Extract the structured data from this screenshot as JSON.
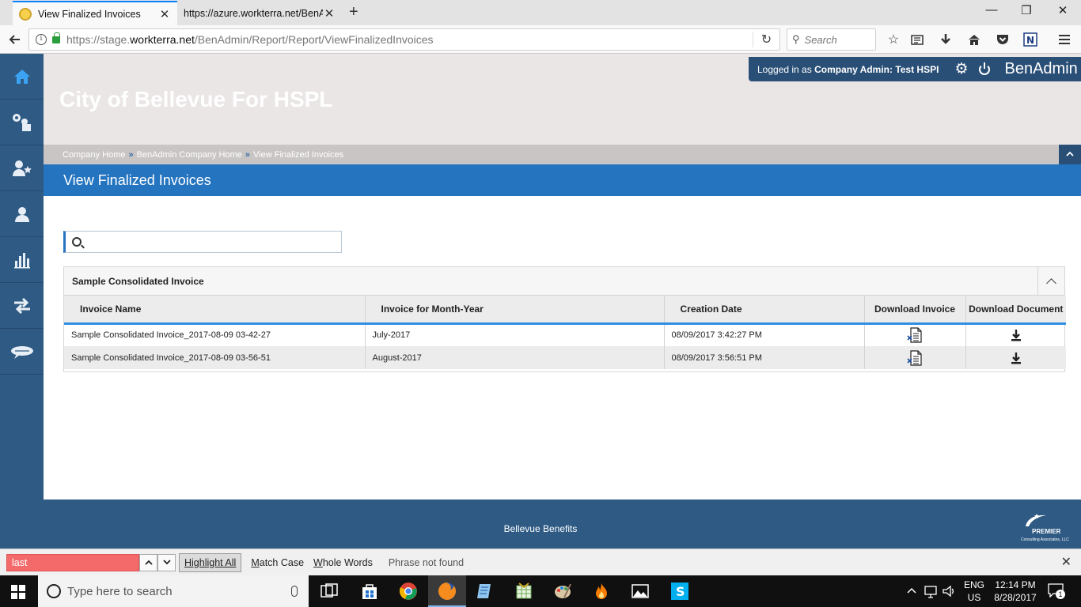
{
  "browser": {
    "tabs": [
      {
        "title": "View Finalized Invoices",
        "active": true
      },
      {
        "title": "https://azure.workterra.net/BenA",
        "active": false
      }
    ],
    "new_tab_symbol": "+",
    "window_controls": {
      "minimize": "—",
      "restore": "❐",
      "close": "✕"
    },
    "url_prefix": "https://stage.",
    "url_domain": "workterra.net",
    "url_path": "/BenAdmin/Report/Report/ViewFinalizedInvoices",
    "search_placeholder": "Search"
  },
  "header": {
    "company_title": "City of Bellevue For HSPL",
    "logged_in_prefix": "Logged in as",
    "role": "Company Admin:",
    "user_name": "Test HSPI",
    "brand": "BenAdmin"
  },
  "breadcrumb": {
    "items": [
      "Company Home",
      "BenAdmin Company Home",
      "View Finalized Invoices"
    ],
    "separator": "»"
  },
  "page_title": "View Finalized Invoices",
  "grid_search": {
    "value": "",
    "placeholder": ""
  },
  "panel": {
    "title": "Sample Consolidated Invoice",
    "columns": [
      "Invoice Name",
      "Invoice for Month-Year",
      "Creation Date",
      "Download Invoice",
      "Download Document"
    ],
    "rows": [
      {
        "name": "Sample Consolidated Invoice_2017-08-09 03-42-27",
        "month_year": "July-2017",
        "created": "08/09/2017 3:42:27 PM"
      },
      {
        "name": "Sample Consolidated Invoice_2017-08-09 03-56-51",
        "month_year": "August-2017",
        "created": "08/09/2017 3:56:51 PM"
      }
    ]
  },
  "footer": {
    "text": "Bellevue Benefits",
    "logo_name": "PREMIER",
    "logo_sub": "Consulting Associates, LLC"
  },
  "findbar": {
    "query": "last",
    "highlight_all": "Highlight All",
    "match_case_u": "M",
    "match_case_rest": "atch Case",
    "whole_words_u": "W",
    "whole_words_rest": "hole Words",
    "status": "Phrase not found"
  },
  "taskbar": {
    "search_placeholder": "Type here to search",
    "lang_line1": "ENG",
    "lang_line2": "US",
    "time": "12:14 PM",
    "date": "8/28/2017",
    "notification_count": "1"
  },
  "colors": {
    "nav_blue": "#2e5a84",
    "title_blue": "#2474c0",
    "userbar_blue": "#2a4f76",
    "findbar_error": "#f46a6a"
  }
}
